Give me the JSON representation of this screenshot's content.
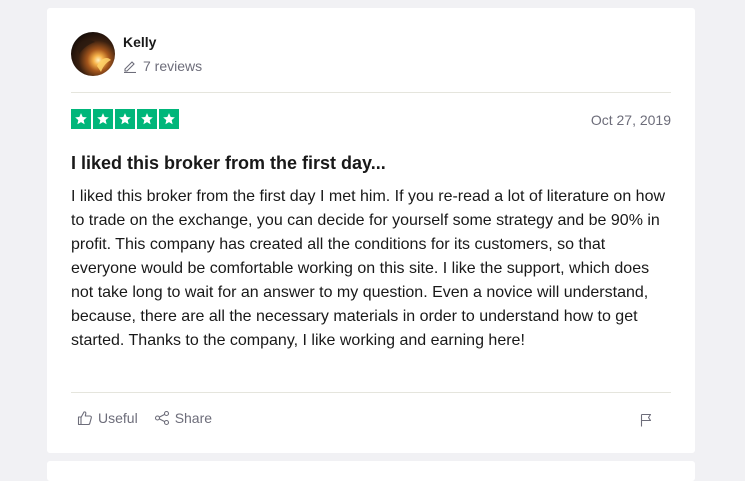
{
  "reviewer": {
    "name": "Kelly",
    "reviews_count": "7 reviews"
  },
  "rating": {
    "stars": 5,
    "max": 5,
    "color": "#00b67a"
  },
  "review": {
    "date": "Oct 27, 2019",
    "title": "I liked this broker from the first day...",
    "body": "I liked this broker from the first day I met him. If you re-read a lot of literature on how to trade on the exchange, you can decide for yourself some strategy and be 90% in profit. This company has created all the conditions for its customers, so that everyone would be comfortable working on this site. I like the support, which does not take long to wait for an answer to my question. Even a novice will understand, because, there are all the necessary materials in order to understand how to get started. Thanks to the company, I like working and earning here!"
  },
  "actions": {
    "useful_label": "Useful",
    "share_label": "Share",
    "icons": [
      "thumbs-up-icon",
      "share-icon",
      "flag-icon"
    ]
  }
}
